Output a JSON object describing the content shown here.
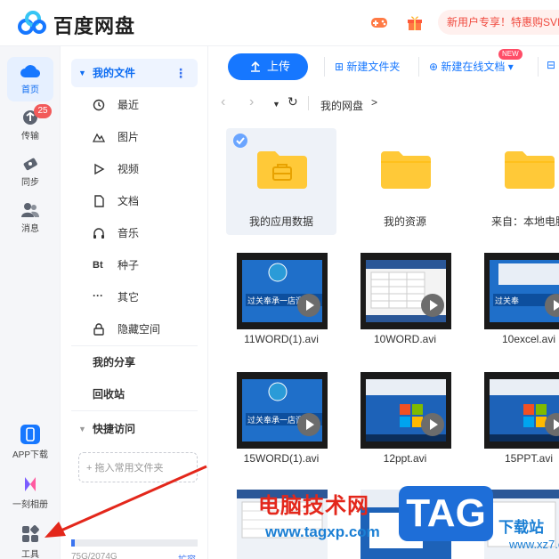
{
  "app": {
    "brand": "百度网盘",
    "promo": "新用户专享！特惠购SVIP"
  },
  "leftnav": {
    "items": [
      {
        "label": "首页",
        "icon": "cloud-icon"
      },
      {
        "label": "传输",
        "icon": "transfer-icon",
        "badge": "25"
      },
      {
        "label": "同步",
        "icon": "sync-icon"
      },
      {
        "label": "消息",
        "icon": "people-icon"
      }
    ],
    "bottom": [
      {
        "label": "APP下载",
        "icon": "phone-icon"
      },
      {
        "label": "一刻相册",
        "icon": "album-icon"
      },
      {
        "label": "工具",
        "icon": "tools-grid-icon"
      }
    ]
  },
  "tree": {
    "my_files": "我的文件",
    "items": [
      {
        "label": "最近",
        "icon": "clock-icon"
      },
      {
        "label": "图片",
        "icon": "image-icon"
      },
      {
        "label": "视频",
        "icon": "play-icon"
      },
      {
        "label": "文档",
        "icon": "doc-icon"
      },
      {
        "label": "音乐",
        "icon": "headphones-icon"
      },
      {
        "label": "种子",
        "icon": "bt-icon",
        "glyph": "Bt"
      },
      {
        "label": "其它",
        "icon": "ellipsis-icon",
        "glyph": "···"
      },
      {
        "label": "隐藏空间",
        "icon": "lock-icon"
      }
    ],
    "my_share": "我的分享",
    "recycle": "回收站",
    "quick_access": "快捷访问",
    "drop_hint": "+ 拖入常用文件夹",
    "quota": "75G/2074G",
    "expand": "扩容"
  },
  "toolbar": {
    "upload": "上传",
    "new_folder": "新建文件夹",
    "new_online_doc": "新建在线文档",
    "new_tag": "NEW"
  },
  "breadcrumb": {
    "root": "我的网盘",
    "arrow": ">"
  },
  "files": {
    "folders": [
      {
        "name": "我的应用数据",
        "selected": true
      },
      {
        "name": "我的资源",
        "selected": false
      },
      {
        "name": "来自：本地电脑",
        "selected": false
      }
    ],
    "videos": [
      {
        "name": "11WORD(1).avi",
        "thumb": "blue-slide"
      },
      {
        "name": "10WORD.avi",
        "thumb": "word-table"
      },
      {
        "name": "10excel.avi",
        "thumb": "excel-desktop"
      },
      {
        "name": "15WORD(1).avi",
        "thumb": "blue-slide"
      },
      {
        "name": "12ppt.avi",
        "thumb": "win7-desktop"
      },
      {
        "name": "15PPT.avi",
        "thumb": "win7-desktop"
      }
    ]
  },
  "watermark": {
    "line1": "电脑技术网",
    "line2": "www.tagxp.com",
    "tag": "TAG",
    "xz7": "下载站",
    "xz7b": "www.xz7.com"
  },
  "colors": {
    "accent": "#1677ff",
    "folder": "#ffc938",
    "badge": "#f25a5a",
    "arrow": "#e3271b"
  }
}
